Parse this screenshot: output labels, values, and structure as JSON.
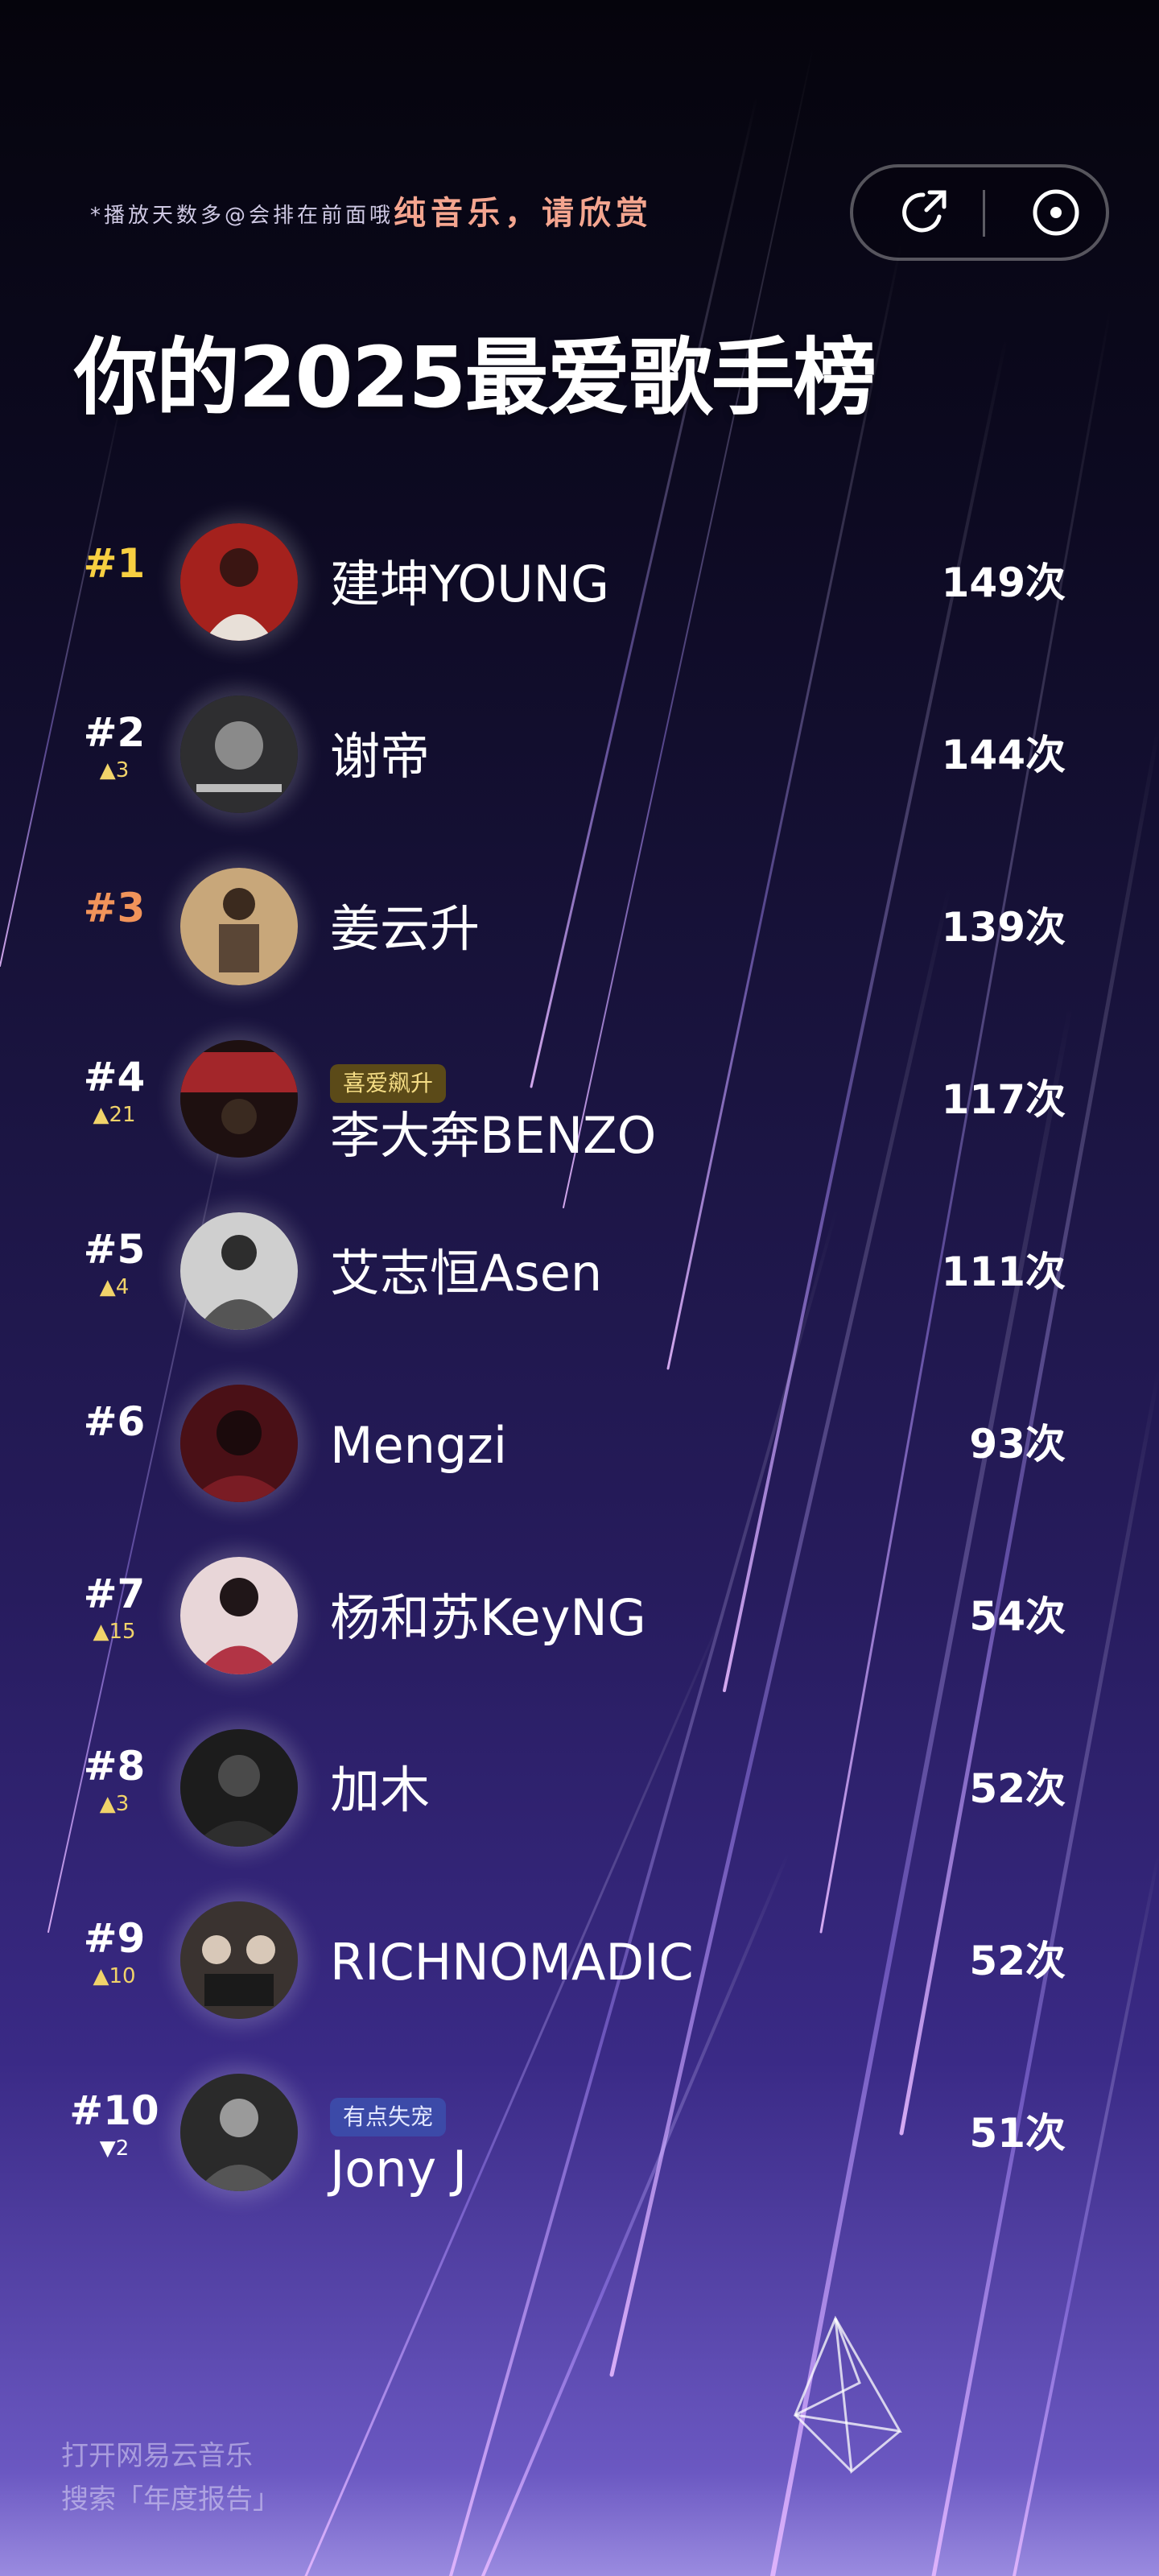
{
  "header": {
    "note": "*播放天数多@会排在前面哦",
    "note_accent": "纯音乐，请欣赏",
    "title": "你的2025最爱歌手榜"
  },
  "actions": {
    "share_icon": "share-arrow-icon",
    "record_icon": "vinyl-record-icon"
  },
  "ranking": [
    {
      "rank": "#1",
      "change": "",
      "name": "建坤YOUNG",
      "tag": "",
      "count": "149次",
      "avatar_color": "#a4211d"
    },
    {
      "rank": "#2",
      "change": "▲3",
      "name": "谢帝",
      "tag": "",
      "count": "144次",
      "avatar_color": "#3a3a3c"
    },
    {
      "rank": "#3",
      "change": "",
      "name": "姜云升",
      "tag": "",
      "count": "139次",
      "avatar_color": "#b99466"
    },
    {
      "rank": "#4",
      "change": "▲21",
      "name": "李大奔BENZO",
      "tag": "喜爱飙升",
      "count": "117次",
      "avatar_color": "#a3262a"
    },
    {
      "rank": "#5",
      "change": "▲4",
      "name": "艾志恒Asen",
      "tag": "",
      "count": "111次",
      "avatar_color": "#6b6b6b"
    },
    {
      "rank": "#6",
      "change": "",
      "name": "Mengzi",
      "tag": "",
      "count": "93次",
      "avatar_color": "#5e141c"
    },
    {
      "rank": "#7",
      "change": "▲15",
      "name": "杨和苏KeyNG",
      "tag": "",
      "count": "54次",
      "avatar_color": "#b23445"
    },
    {
      "rank": "#8",
      "change": "▲3",
      "name": "加木",
      "tag": "",
      "count": "52次",
      "avatar_color": "#2a2a2a"
    },
    {
      "rank": "#9",
      "change": "▲10",
      "name": "RICHNOMADIC",
      "tag": "",
      "count": "52次",
      "avatar_color": "#6a5d50"
    },
    {
      "rank": "#10",
      "change": "▼2",
      "name": "Jony J",
      "tag": "有点失宠",
      "count": "51次",
      "avatar_color": "#3b3b3b"
    }
  ],
  "footer": {
    "line1": "打开网易云音乐",
    "line2": "搜索「年度报告」"
  },
  "colors": {
    "gold": "#f7cf41",
    "bronze": "#f0935a",
    "rise_change": "#f1d36a",
    "tag_rise_bg": "#5b4a18",
    "tag_lost_bg": "#3c4aa8"
  }
}
